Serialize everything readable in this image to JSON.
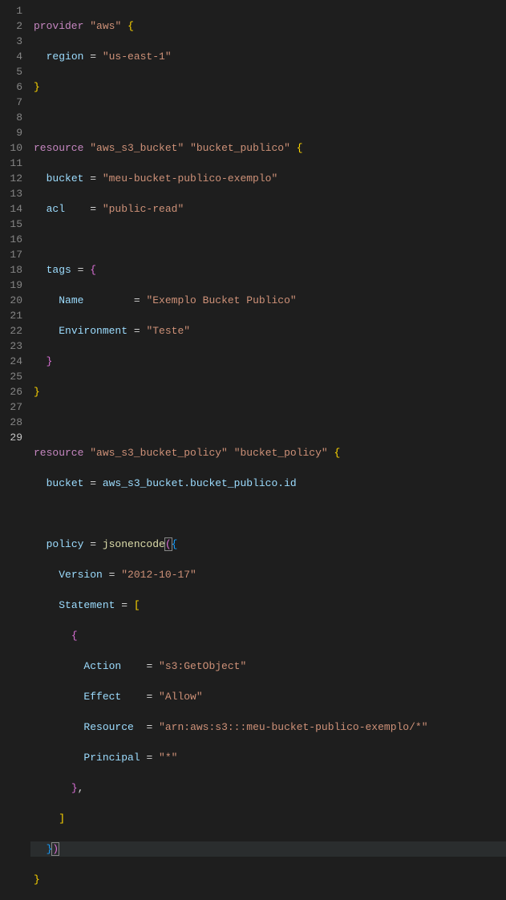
{
  "editor": {
    "language": "terraform",
    "active_line": 28,
    "line_count": 29,
    "lines": {
      "kw_provider": "provider",
      "kw_resource": "resource",
      "provider_name": "\"aws\"",
      "region_key": "region",
      "region_val": "\"us-east-1\"",
      "res_s3_bucket_type": "\"aws_s3_bucket\"",
      "res_s3_bucket_name": "\"bucket_publico\"",
      "bucket_key": "bucket",
      "bucket_val": "\"meu-bucket-publico-exemplo\"",
      "acl_key": "acl",
      "acl_val": "\"public-read\"",
      "tags_key": "tags",
      "name_key": "Name",
      "name_val": "\"Exemplo Bucket Publico\"",
      "env_key": "Environment",
      "env_val": "\"Teste\"",
      "res_policy_type": "\"aws_s3_bucket_policy\"",
      "res_policy_name": "\"bucket_policy\"",
      "bucket_ref": "aws_s3_bucket.bucket_publico.id",
      "policy_key": "policy",
      "jsonencode_func": "jsonencode",
      "version_key": "Version",
      "version_val": "\"2012-10-17\"",
      "statement_key": "Statement",
      "action_key": "Action",
      "action_val": "\"s3:GetObject\"",
      "effect_key": "Effect",
      "effect_val": "\"Allow\"",
      "resource_key": "Resource",
      "resource_val": "\"arn:aws:s3:::meu-bucket-publico-exemplo/*\"",
      "principal_key": "Principal",
      "principal_val": "\"*\"",
      "eq": " = ",
      "open_brace": "{",
      "close_brace": "}",
      "open_bracket": "[",
      "close_bracket": "]",
      "open_paren": "(",
      "close_paren": ")",
      "comma": ","
    },
    "line_numbers": [
      "1",
      "2",
      "3",
      "4",
      "5",
      "6",
      "7",
      "8",
      "9",
      "10",
      "11",
      "12",
      "13",
      "14",
      "15",
      "16",
      "17",
      "18",
      "19",
      "20",
      "21",
      "22",
      "23",
      "24",
      "25",
      "26",
      "27",
      "28",
      "29"
    ]
  }
}
